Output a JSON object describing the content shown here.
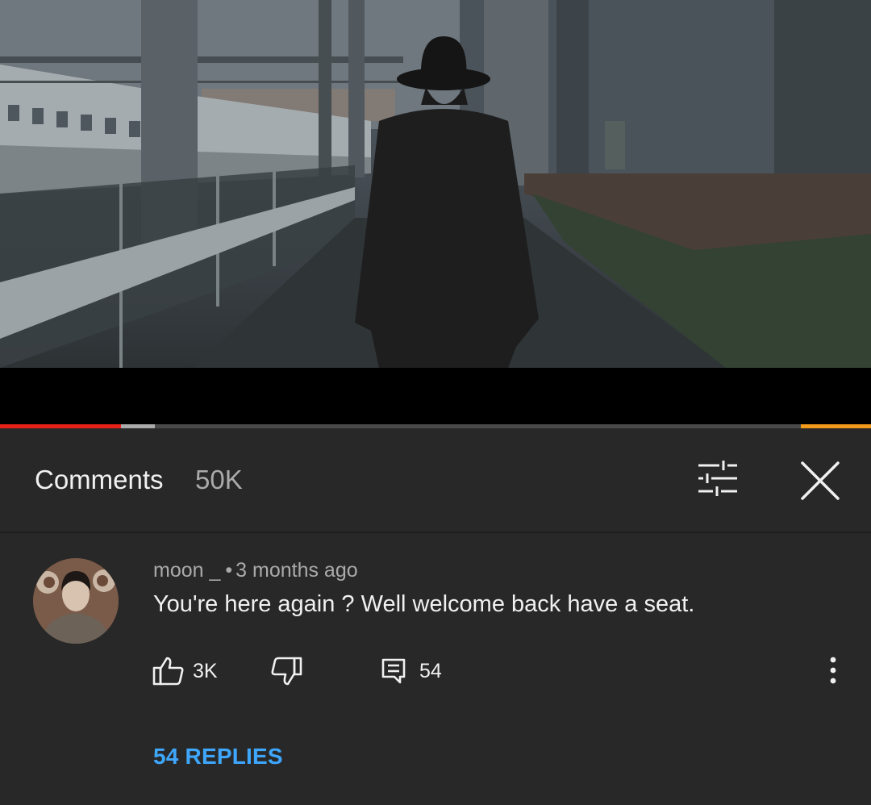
{
  "video": {
    "progress_played": 0.139,
    "progress_buffered": 0.178
  },
  "comments": {
    "title": "Comments",
    "count": "50K"
  },
  "comment": {
    "author": "moon _",
    "separator": "•",
    "time": "3 months ago",
    "text": "You're here again ? Well welcome back have a seat.",
    "likes": "3K",
    "reply_count": "54",
    "replies_label": "54 REPLIES"
  },
  "colors": {
    "background": "#282828",
    "progress_played": "#e62117",
    "link": "#3ea6ff"
  }
}
